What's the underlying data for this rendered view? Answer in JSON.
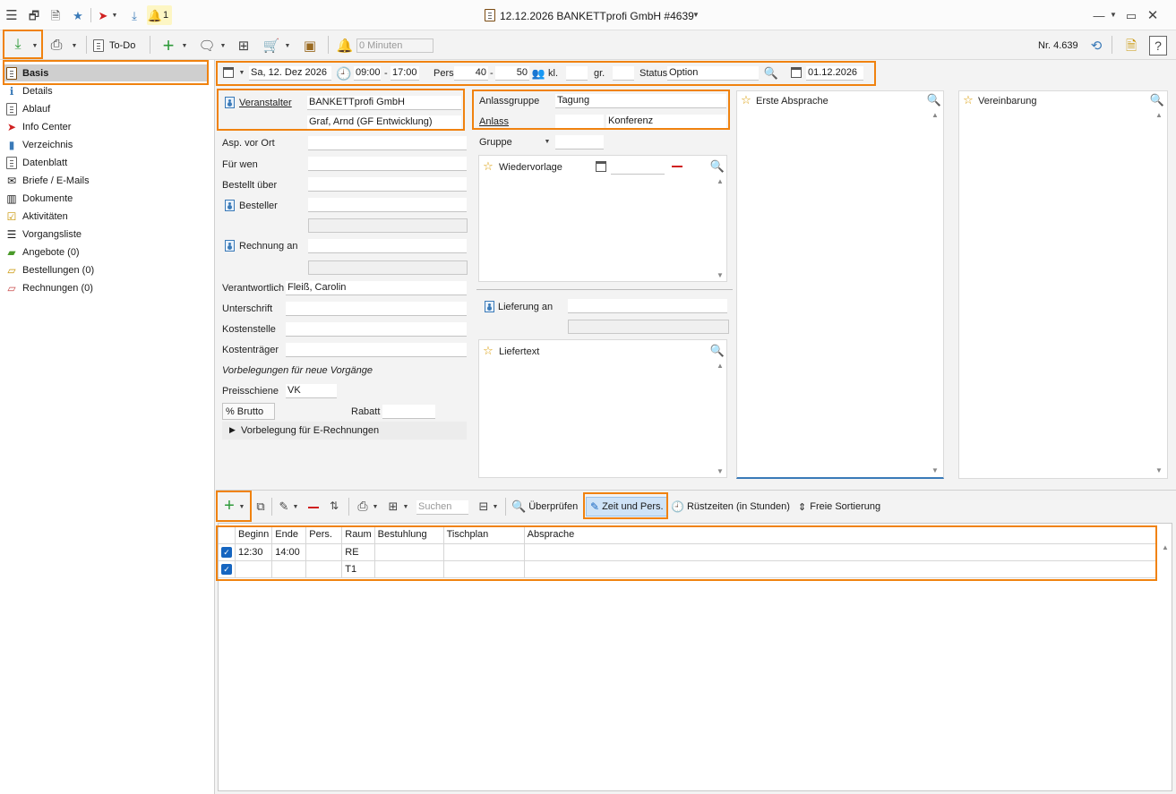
{
  "window": {
    "title": "12.12.2026 BANKETTprofi GmbH #4639",
    "bell_count": "1"
  },
  "toolbar": {
    "todo_label": "To-Do",
    "minutes_placeholder": "0 Minuten",
    "number_label": "Nr. 4.639"
  },
  "sidebar": {
    "items": [
      {
        "label": "Basis",
        "icon": "document-icon"
      },
      {
        "label": "Details",
        "icon": "info-icon"
      },
      {
        "label": "Ablauf",
        "icon": "list-icon"
      },
      {
        "label": "Info Center",
        "icon": "compass-icon"
      },
      {
        "label": "Verzeichnis",
        "icon": "book-icon"
      },
      {
        "label": "Datenblatt",
        "icon": "sheet-icon"
      },
      {
        "label": "Briefe / E-Mails",
        "icon": "letter-icon"
      },
      {
        "label": "Dokumente",
        "icon": "documents-icon"
      },
      {
        "label": "Aktivitäten",
        "icon": "check-icon"
      },
      {
        "label": "Vorgangsliste",
        "icon": "list-icon"
      },
      {
        "label": "Angebote (0)",
        "icon": "folder-green-icon"
      },
      {
        "label": "Bestellungen (0)",
        "icon": "folder-yellow-icon"
      },
      {
        "label": "Rechnungen (0)",
        "icon": "folder-red-icon"
      }
    ]
  },
  "header": {
    "date": "Sa, 12. Dez 2026",
    "time_from": "09:00",
    "time_sep": "-",
    "time_to": "17:00",
    "pers_label": "Pers.",
    "pers_from": "40",
    "pers_sep": "-",
    "pers_to": "50",
    "kl_label": "kl.",
    "gr_label": "gr.",
    "status_label": "Status",
    "status_value": "Option",
    "date2": "01.12.2026"
  },
  "left_form": {
    "veranstalter_label": "Veranstalter",
    "veranstalter_value": "BANKETTprofi GmbH",
    "contact_value": "Graf, Arnd (GF Entwicklung)",
    "asp_label": "Asp. vor Ort",
    "fuer_wen_label": "Für wen",
    "bestellt_label": "Bestellt über",
    "besteller_label": "Besteller",
    "rechnung_label": "Rechnung an",
    "verantwortlich_label": "Verantwortlich",
    "verantwortlich_value": "Fleiß, Carolin",
    "unterschrift_label": "Unterschrift",
    "kostenstelle_label": "Kostenstelle",
    "kostentraeger_label": "Kostenträger",
    "vorbelegungen_label": "Vorbelegungen für neue Vorgänge",
    "preisschiene_label": "Preisschiene",
    "preisschiene_value": "VK",
    "brutto_label": "Brutto",
    "rabatt_label": "Rabatt",
    "erechnung_label": "Vorbelegung für E-Rechnungen"
  },
  "mid_form": {
    "anlassgruppe_label": "Anlassgruppe",
    "anlassgruppe_value": "Tagung",
    "anlass_label": "Anlass",
    "anlass_value": "Konferenz",
    "gruppe_label": "Gruppe",
    "wiedervorlage_label": "Wiedervorlage",
    "lieferung_label": "Lieferung an",
    "liefertext_label": "Liefertext"
  },
  "panels": {
    "erste_absprache": "Erste Absprache",
    "vereinbarung": "Vereinbarung"
  },
  "bottom_toolbar": {
    "search_placeholder": "Suchen",
    "ueberpruefen": "Überprüfen",
    "zeit_pers": "Zeit und Pers.",
    "ruestzeiten": "Rüstzeiten (in Stunden)",
    "freie_sortierung": "Freie Sortierung"
  },
  "grid": {
    "columns": [
      "Beginn",
      "Ende",
      "Pers.",
      "Raum",
      "Bestuhlung",
      "Tischplan",
      "Absprache"
    ],
    "rows": [
      [
        "12:30",
        "14:00",
        "",
        "RE",
        "",
        "",
        ""
      ],
      [
        "",
        "",
        "",
        "T1",
        "",
        "",
        ""
      ]
    ]
  },
  "colors": {
    "highlight": "#f0820f",
    "accent": "#1565c0"
  }
}
